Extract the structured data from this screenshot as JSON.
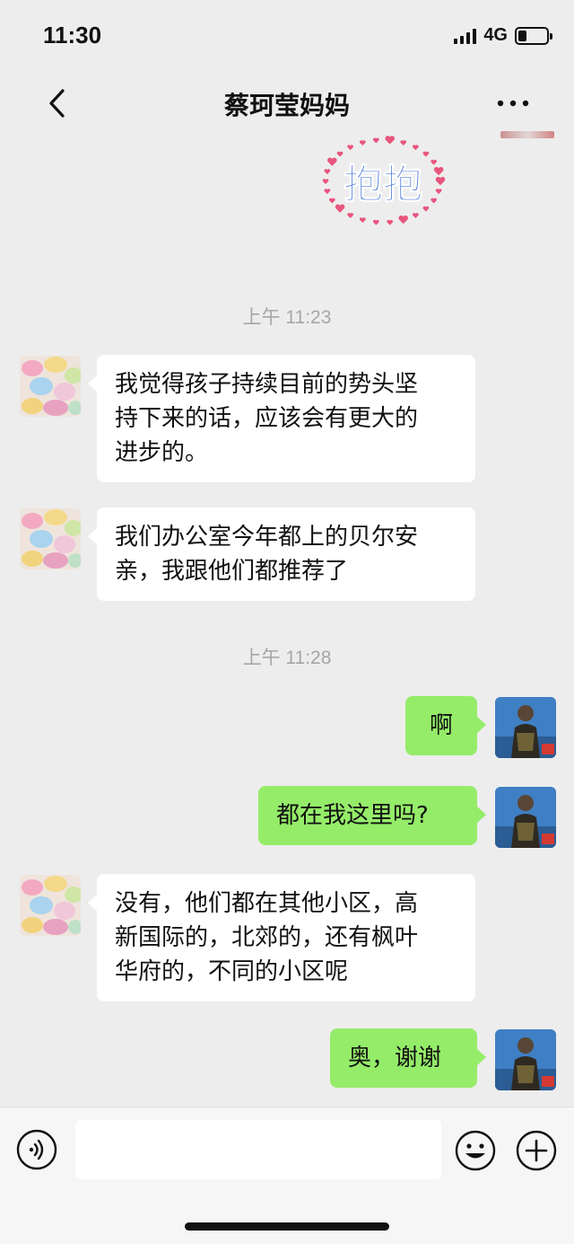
{
  "status_bar": {
    "time": "11:30",
    "network": "4G"
  },
  "nav": {
    "title": "蔡珂莹妈妈"
  },
  "sticker": {
    "text": "抱抱",
    "color": "#3d6fd6",
    "heart_color": "#e8557d"
  },
  "messages": [
    {
      "type": "time",
      "text": "上午 11:23"
    },
    {
      "type": "in",
      "text_lines": [
        "我觉得孩子持续目前的势头坚",
        "持下来的话，应该会有更大的",
        "进步的。"
      ]
    },
    {
      "type": "in",
      "text_lines": [
        "我们办公室今年都上的贝尔安",
        "亲，我跟他们都推荐了"
      ]
    },
    {
      "type": "time",
      "text": "上午 11:28"
    },
    {
      "type": "out",
      "text_lines": [
        "啊"
      ]
    },
    {
      "type": "out",
      "text_lines": [
        "都在我这里吗?"
      ]
    },
    {
      "type": "in",
      "text_lines": [
        "没有，他们都在其他小区，高",
        "新国际的，北郊的，还有枫叶",
        "华府的，不同的小区呢"
      ]
    },
    {
      "type": "out",
      "text_lines": [
        "奥，谢谢"
      ]
    }
  ],
  "input": {
    "value": "",
    "placeholder": ""
  },
  "colors": {
    "background": "#ededed",
    "bubble_out": "#95ec69",
    "bubble_in": "#ffffff",
    "timestamp": "#a6a6a6"
  }
}
